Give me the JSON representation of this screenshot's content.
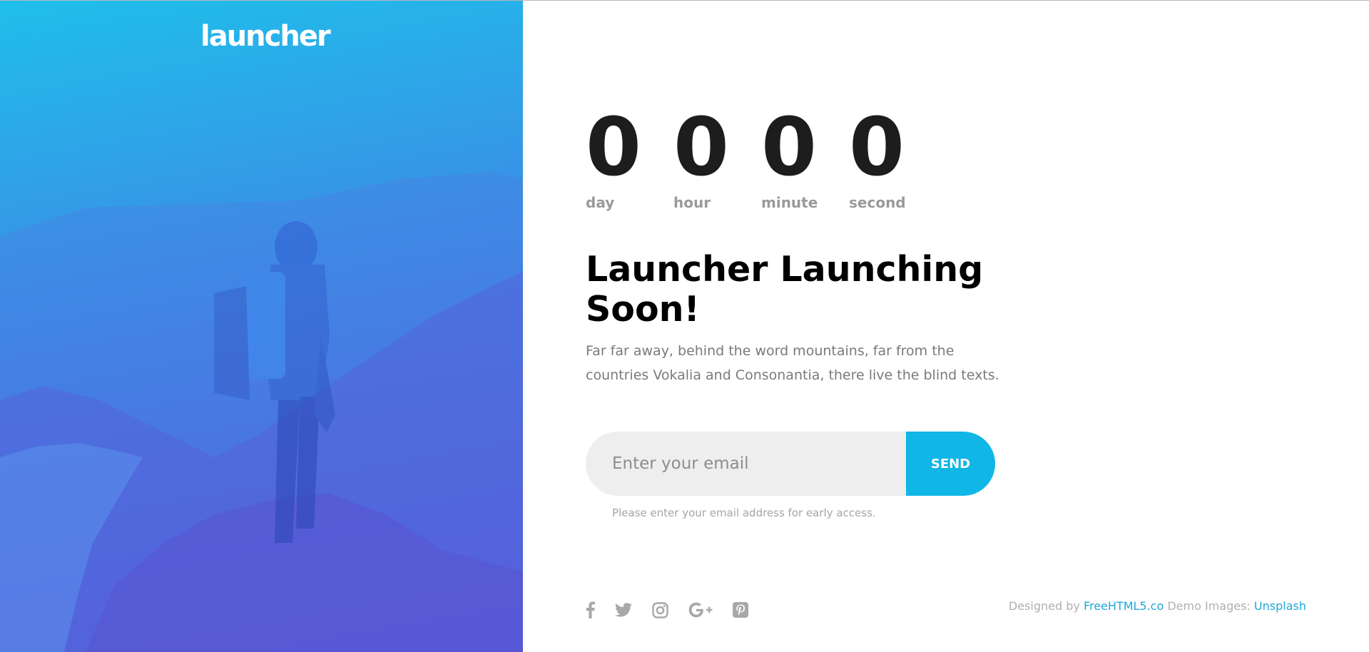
{
  "brand": {
    "logo_text": "launcher"
  },
  "countdown": [
    {
      "value": "0",
      "label": "day"
    },
    {
      "value": "0",
      "label": "hour"
    },
    {
      "value": "0",
      "label": "minute"
    },
    {
      "value": "0",
      "label": "second"
    }
  ],
  "hero": {
    "headline": "Launcher Launching Soon!",
    "lead": "Far far away, behind the word mountains, far from the countries Vokalia and Consonantia, there live the blind texts."
  },
  "signup": {
    "email_placeholder": "Enter your email",
    "send_label": "SEND",
    "hint": "Please enter your email address for early access."
  },
  "social": [
    {
      "name": "facebook-icon"
    },
    {
      "name": "twitter-icon"
    },
    {
      "name": "instagram-icon"
    },
    {
      "name": "google-plus-icon"
    },
    {
      "name": "pinterest-icon"
    }
  ],
  "footer": {
    "designed_by_prefix": "Designed by",
    "designer_link": "FreeHTML5.co",
    "demo_images_prefix": "Demo Images:",
    "images_link": "Unsplash"
  },
  "colors": {
    "accent": "#0fb6e6",
    "link": "#1fa7da",
    "gradient_top": "#1fbfea",
    "gradient_bottom": "#5b4fdc"
  }
}
